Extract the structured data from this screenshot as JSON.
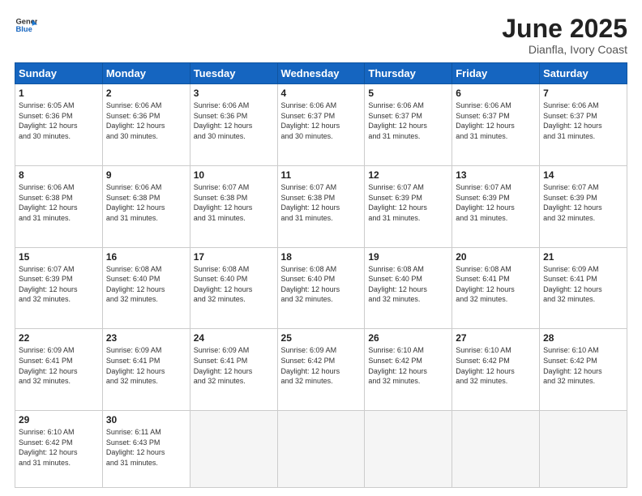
{
  "header": {
    "logo_line1": "General",
    "logo_line2": "Blue",
    "title": "June 2025",
    "subtitle": "Dianfla, Ivory Coast"
  },
  "weekdays": [
    "Sunday",
    "Monday",
    "Tuesday",
    "Wednesday",
    "Thursday",
    "Friday",
    "Saturday"
  ],
  "weeks": [
    [
      {
        "day": "1",
        "info": "Sunrise: 6:05 AM\nSunset: 6:36 PM\nDaylight: 12 hours\nand 30 minutes."
      },
      {
        "day": "2",
        "info": "Sunrise: 6:06 AM\nSunset: 6:36 PM\nDaylight: 12 hours\nand 30 minutes."
      },
      {
        "day": "3",
        "info": "Sunrise: 6:06 AM\nSunset: 6:36 PM\nDaylight: 12 hours\nand 30 minutes."
      },
      {
        "day": "4",
        "info": "Sunrise: 6:06 AM\nSunset: 6:37 PM\nDaylight: 12 hours\nand 30 minutes."
      },
      {
        "day": "5",
        "info": "Sunrise: 6:06 AM\nSunset: 6:37 PM\nDaylight: 12 hours\nand 31 minutes."
      },
      {
        "day": "6",
        "info": "Sunrise: 6:06 AM\nSunset: 6:37 PM\nDaylight: 12 hours\nand 31 minutes."
      },
      {
        "day": "7",
        "info": "Sunrise: 6:06 AM\nSunset: 6:37 PM\nDaylight: 12 hours\nand 31 minutes."
      }
    ],
    [
      {
        "day": "8",
        "info": "Sunrise: 6:06 AM\nSunset: 6:38 PM\nDaylight: 12 hours\nand 31 minutes."
      },
      {
        "day": "9",
        "info": "Sunrise: 6:06 AM\nSunset: 6:38 PM\nDaylight: 12 hours\nand 31 minutes."
      },
      {
        "day": "10",
        "info": "Sunrise: 6:07 AM\nSunset: 6:38 PM\nDaylight: 12 hours\nand 31 minutes."
      },
      {
        "day": "11",
        "info": "Sunrise: 6:07 AM\nSunset: 6:38 PM\nDaylight: 12 hours\nand 31 minutes."
      },
      {
        "day": "12",
        "info": "Sunrise: 6:07 AM\nSunset: 6:39 PM\nDaylight: 12 hours\nand 31 minutes."
      },
      {
        "day": "13",
        "info": "Sunrise: 6:07 AM\nSunset: 6:39 PM\nDaylight: 12 hours\nand 31 minutes."
      },
      {
        "day": "14",
        "info": "Sunrise: 6:07 AM\nSunset: 6:39 PM\nDaylight: 12 hours\nand 32 minutes."
      }
    ],
    [
      {
        "day": "15",
        "info": "Sunrise: 6:07 AM\nSunset: 6:39 PM\nDaylight: 12 hours\nand 32 minutes."
      },
      {
        "day": "16",
        "info": "Sunrise: 6:08 AM\nSunset: 6:40 PM\nDaylight: 12 hours\nand 32 minutes."
      },
      {
        "day": "17",
        "info": "Sunrise: 6:08 AM\nSunset: 6:40 PM\nDaylight: 12 hours\nand 32 minutes."
      },
      {
        "day": "18",
        "info": "Sunrise: 6:08 AM\nSunset: 6:40 PM\nDaylight: 12 hours\nand 32 minutes."
      },
      {
        "day": "19",
        "info": "Sunrise: 6:08 AM\nSunset: 6:40 PM\nDaylight: 12 hours\nand 32 minutes."
      },
      {
        "day": "20",
        "info": "Sunrise: 6:08 AM\nSunset: 6:41 PM\nDaylight: 12 hours\nand 32 minutes."
      },
      {
        "day": "21",
        "info": "Sunrise: 6:09 AM\nSunset: 6:41 PM\nDaylight: 12 hours\nand 32 minutes."
      }
    ],
    [
      {
        "day": "22",
        "info": "Sunrise: 6:09 AM\nSunset: 6:41 PM\nDaylight: 12 hours\nand 32 minutes."
      },
      {
        "day": "23",
        "info": "Sunrise: 6:09 AM\nSunset: 6:41 PM\nDaylight: 12 hours\nand 32 minutes."
      },
      {
        "day": "24",
        "info": "Sunrise: 6:09 AM\nSunset: 6:41 PM\nDaylight: 12 hours\nand 32 minutes."
      },
      {
        "day": "25",
        "info": "Sunrise: 6:09 AM\nSunset: 6:42 PM\nDaylight: 12 hours\nand 32 minutes."
      },
      {
        "day": "26",
        "info": "Sunrise: 6:10 AM\nSunset: 6:42 PM\nDaylight: 12 hours\nand 32 minutes."
      },
      {
        "day": "27",
        "info": "Sunrise: 6:10 AM\nSunset: 6:42 PM\nDaylight: 12 hours\nand 32 minutes."
      },
      {
        "day": "28",
        "info": "Sunrise: 6:10 AM\nSunset: 6:42 PM\nDaylight: 12 hours\nand 32 minutes."
      }
    ],
    [
      {
        "day": "29",
        "info": "Sunrise: 6:10 AM\nSunset: 6:42 PM\nDaylight: 12 hours\nand 31 minutes."
      },
      {
        "day": "30",
        "info": "Sunrise: 6:11 AM\nSunset: 6:43 PM\nDaylight: 12 hours\nand 31 minutes."
      },
      {
        "day": "",
        "info": ""
      },
      {
        "day": "",
        "info": ""
      },
      {
        "day": "",
        "info": ""
      },
      {
        "day": "",
        "info": ""
      },
      {
        "day": "",
        "info": ""
      }
    ]
  ]
}
